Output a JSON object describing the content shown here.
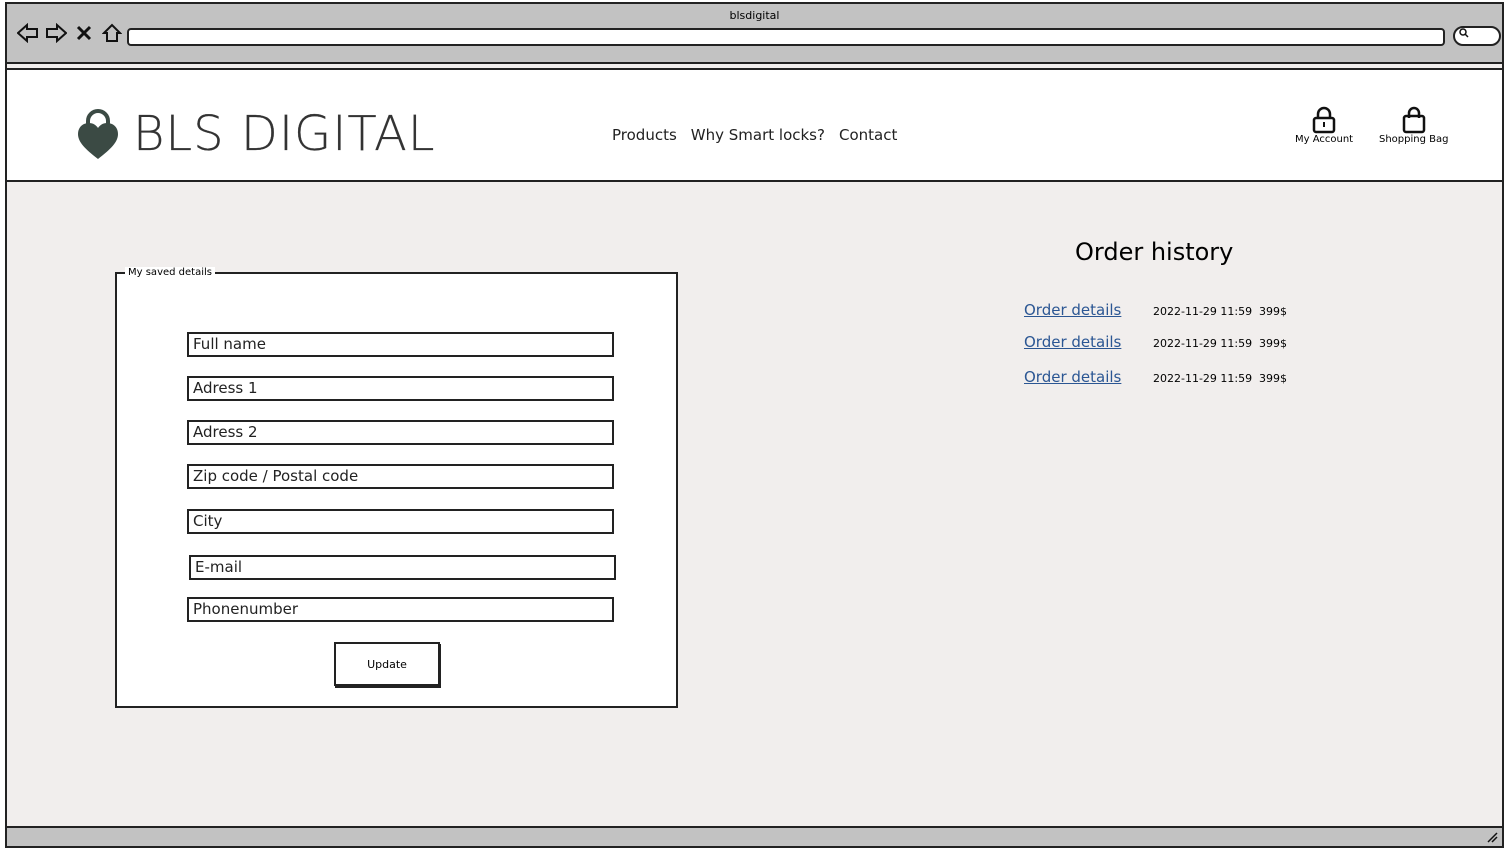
{
  "browser": {
    "title": "blsdigital",
    "icons": [
      "back-arrow-icon",
      "forward-arrow-icon",
      "close-icon",
      "home-icon"
    ]
  },
  "header": {
    "logo_text": "BLS DIGITAL",
    "nav": [
      {
        "label": "Products"
      },
      {
        "label": "Why Smart locks?"
      },
      {
        "label": "Contact"
      }
    ],
    "my_account_label": "My Account",
    "shopping_bag_label": "Shopping Bag"
  },
  "saved_details": {
    "legend": "My saved details",
    "fields": [
      {
        "placeholder": "Full name"
      },
      {
        "placeholder": "Adress 1"
      },
      {
        "placeholder": "Adress 2"
      },
      {
        "placeholder": "Zip code / Postal code"
      },
      {
        "placeholder": "City"
      },
      {
        "placeholder": "E-mail"
      },
      {
        "placeholder": "Phonenumber"
      }
    ],
    "update_label": "Update"
  },
  "order_history": {
    "title": "Order history",
    "orders": [
      {
        "link": "Order details",
        "date": "2022-11-29 11:59",
        "price": "399$"
      },
      {
        "link": "Order details",
        "date": "2022-11-29 11:59",
        "price": "399$"
      },
      {
        "link": "Order details",
        "date": "2022-11-29 11:59",
        "price": "399$"
      }
    ]
  },
  "colors": {
    "chrome": "#c2c2c2",
    "page_bg": "#f1eeed",
    "link": "#2b5693",
    "logo": "#333333"
  }
}
